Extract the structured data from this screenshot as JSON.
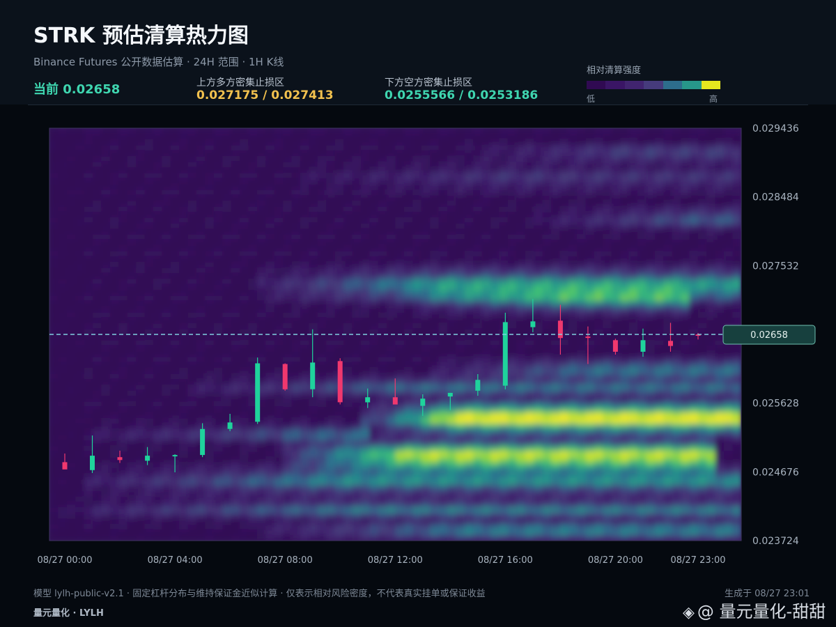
{
  "header": {
    "title": "STRK 预估清算热力图",
    "subtitle": "Binance Futures 公开数据估算 · 24H 范围 · 1H K线",
    "current": "当前 0.02658",
    "upper_label": "上方多方密集止损区",
    "upper_values": "0.027175 / 0.027413",
    "lower_label": "下方空方密集止损区",
    "lower_values": "0.0255566 / 0.0253186"
  },
  "legend": {
    "title": "相对清算强度",
    "low": "低",
    "high": "高",
    "colors": [
      "#300a52",
      "#3a1565",
      "#41246f",
      "#463b7c",
      "#2d6d8c",
      "#27978a",
      "#e6e71f"
    ]
  },
  "footer": {
    "note": "模型 lylh-public-v2.1 · 固定杠杆分布与维持保证金近似计算 · 仅表示相对风险密度，不代表真实挂单或保证收益",
    "brand": "量元量化 · LYLH",
    "generated": "生成于 08/27 23:01",
    "watermark": "@ 量元量化-甜甜",
    "watermark_icon": "binance-diamond-icon"
  },
  "colors": {
    "bull": "#1fd39c",
    "bear": "#f0386e",
    "current_line": "#7fd0e0",
    "price_tag_bg": "#17403e"
  },
  "chart_data": {
    "type": "heatmap",
    "x_label_ticks": [
      "08/27 00:00",
      "08/27 04:00",
      "08/27 08:00",
      "08/27 12:00",
      "08/27 16:00",
      "08/27 20:00",
      "08/27 23:00"
    ],
    "y_ticks": [
      0.029436,
      0.028484,
      0.027532,
      0.02658,
      0.025628,
      0.024676,
      0.023724
    ],
    "y_tick_labels": [
      "0.029436",
      "0.028484",
      "0.027532",
      "",
      "0.025628",
      "0.024676",
      "0.023724"
    ],
    "ylim": [
      0.023724,
      0.029436
    ],
    "current_price": 0.02658,
    "current_price_label": "0.02658",
    "candles": [
      {
        "o": 0.02481,
        "h": 0.02493,
        "l": 0.02473,
        "c": 0.02471
      },
      {
        "o": 0.0247,
        "h": 0.02518,
        "l": 0.02466,
        "c": 0.0249
      },
      {
        "o": 0.02488,
        "h": 0.02497,
        "l": 0.0248,
        "c": 0.02484
      },
      {
        "o": 0.02483,
        "h": 0.02502,
        "l": 0.02477,
        "c": 0.0249
      },
      {
        "o": 0.0249,
        "h": 0.02492,
        "l": 0.02467,
        "c": 0.02491
      },
      {
        "o": 0.02491,
        "h": 0.02535,
        "l": 0.02488,
        "c": 0.02527
      },
      {
        "o": 0.02527,
        "h": 0.02548,
        "l": 0.02524,
        "c": 0.02536
      },
      {
        "o": 0.02537,
        "h": 0.02626,
        "l": 0.02534,
        "c": 0.02618
      },
      {
        "o": 0.02617,
        "h": 0.02618,
        "l": 0.0258,
        "c": 0.02582
      },
      {
        "o": 0.02582,
        "h": 0.02665,
        "l": 0.02571,
        "c": 0.02619
      },
      {
        "o": 0.02621,
        "h": 0.02625,
        "l": 0.02561,
        "c": 0.02564
      },
      {
        "o": 0.02564,
        "h": 0.02583,
        "l": 0.02556,
        "c": 0.02571
      },
      {
        "o": 0.02571,
        "h": 0.02597,
        "l": 0.02561,
        "c": 0.02561
      },
      {
        "o": 0.02559,
        "h": 0.02575,
        "l": 0.02545,
        "c": 0.02569
      },
      {
        "o": 0.02572,
        "h": 0.02577,
        "l": 0.02553,
        "c": 0.02577
      },
      {
        "o": 0.0258,
        "h": 0.02603,
        "l": 0.02573,
        "c": 0.02595
      },
      {
        "o": 0.02587,
        "h": 0.02688,
        "l": 0.02582,
        "c": 0.02675
      },
      {
        "o": 0.02668,
        "h": 0.02707,
        "l": 0.02661,
        "c": 0.02676
      },
      {
        "o": 0.02677,
        "h": 0.02699,
        "l": 0.0263,
        "c": 0.02653
      },
      {
        "o": 0.02655,
        "h": 0.02669,
        "l": 0.02617,
        "c": 0.02654
      },
      {
        "o": 0.0265,
        "h": 0.02652,
        "l": 0.0263,
        "c": 0.02634
      },
      {
        "o": 0.02634,
        "h": 0.02666,
        "l": 0.02627,
        "c": 0.0265
      },
      {
        "o": 0.02649,
        "h": 0.02674,
        "l": 0.02634,
        "c": 0.02642
      },
      {
        "o": 0.02658,
        "h": 0.0266,
        "l": 0.02651,
        "c": 0.02657
      }
    ]
  }
}
